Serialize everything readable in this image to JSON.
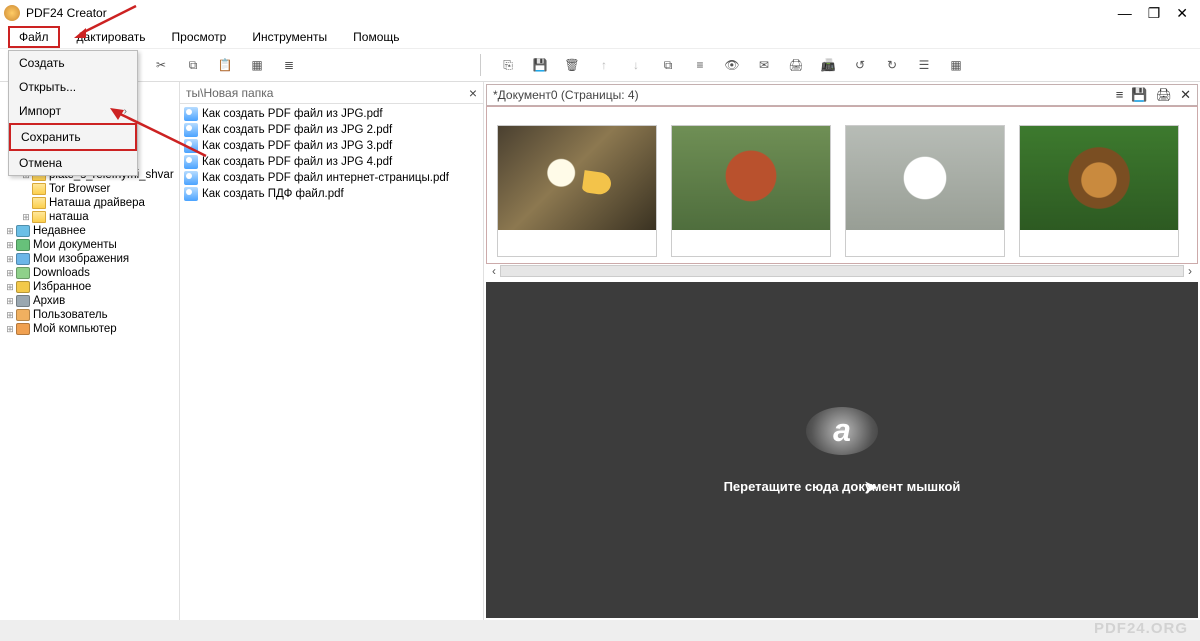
{
  "app": {
    "title": "PDF24 Creator"
  },
  "window_controls": {
    "min": "—",
    "max": "❐",
    "close": "✕"
  },
  "menubar": {
    "file": "Файл",
    "edit": "дактировать",
    "view": "Просмотр",
    "tools": "Инструменты",
    "help": "Помощь"
  },
  "file_menu": {
    "create": "Создать",
    "open": "Открыть...",
    "import": "Импорт",
    "save": "Сохранить",
    "cancel": "Отмена",
    "arrow": "›"
  },
  "left_toolbar_icons": [
    "scissors-icon",
    "copy-icon",
    "clipboard-icon",
    "grid-icon",
    "list-icon"
  ],
  "right_toolbar_icons": [
    "new-doc-icon",
    "save-icon",
    "delete-icon",
    "arrow-up-icon",
    "arrow-down-icon",
    "link-icon",
    "stream-icon",
    "eye-icon",
    "mail-icon",
    "print-icon",
    "fax-icon",
    "rotate-left-icon",
    "rotate-right-icon",
    "properties-icon",
    "tiles-icon"
  ],
  "right_toolbar_dim": [
    "arrow-up-icon",
    "arrow-down-icon"
  ],
  "toolbar_glyphs": {
    "scissors-icon": "✂",
    "copy-icon": "⧉",
    "clipboard-icon": "📋",
    "grid-icon": "▦",
    "list-icon": "≣",
    "new-doc-icon": "⎘",
    "save-icon": "💾",
    "delete-icon": "🗑",
    "arrow-up-icon": "↑",
    "arrow-down-icon": "↓",
    "link-icon": "⧉",
    "stream-icon": "≡",
    "eye-icon": "👁",
    "mail-icon": "✉",
    "print-icon": "🖨",
    "fax-icon": "📠",
    "rotate-left-icon": "↺",
    "rotate-right-icon": "↻",
    "properties-icon": "☰",
    "tiles-icon": "▦"
  },
  "path_bar": {
    "text": "ты\\Новая папка"
  },
  "tree": [
    {
      "exp": "⊞",
      "icon": "folder",
      "label": "plate_s_relefnymi_shvar",
      "indent": 1
    },
    {
      "exp": "",
      "icon": "folder",
      "label": "Tor Browser",
      "indent": 1
    },
    {
      "exp": "",
      "icon": "folder",
      "label": "Наташа драйвера",
      "indent": 1
    },
    {
      "exp": "⊞",
      "icon": "folder",
      "label": "наташа",
      "indent": 1
    },
    {
      "exp": "⊞",
      "icon": "recent",
      "label": "Недавнее",
      "indent": 0
    },
    {
      "exp": "⊞",
      "icon": "docs",
      "label": "Мои документы",
      "indent": 0
    },
    {
      "exp": "⊞",
      "icon": "images",
      "label": "Мои изображения",
      "indent": 0
    },
    {
      "exp": "⊞",
      "icon": "downloads",
      "label": "Downloads",
      "indent": 0
    },
    {
      "exp": "⊞",
      "icon": "fav",
      "label": "Избранное",
      "indent": 0
    },
    {
      "exp": "⊞",
      "icon": "archive",
      "label": "Архив",
      "indent": 0
    },
    {
      "exp": "⊞",
      "icon": "user",
      "label": "Пользователь",
      "indent": 0
    },
    {
      "exp": "⊞",
      "icon": "computer",
      "label": "Мой компьютер",
      "indent": 0
    }
  ],
  "tree_icon_colors": {
    "folder": "folder-ic",
    "recent": "#6bbfe6",
    "docs": "#67c17a",
    "images": "#6cb6e8",
    "downloads": "#8fd18a",
    "fav": "#f3c94a",
    "archive": "#9aa7b0",
    "user": "#f0b060",
    "computer": "#f0a050"
  },
  "files": [
    "Как создать PDF файл из JPG.pdf",
    "Как создать PDF файл из JPG 2.pdf",
    "Как создать PDF файл из JPG 3.pdf",
    "Как создать PDF файл из JPG 4.pdf",
    "Как создать PDF файл интернет-страницы.pdf",
    "Как создать ПДФ файл.pdf"
  ],
  "doc_header": {
    "title": "*Документ0 (Страницы: 4)"
  },
  "doc_header_icons": [
    "menu-icon",
    "save-icon",
    "print-icon",
    "close-icon"
  ],
  "doc_header_glyphs": {
    "menu-icon": "≡",
    "save-icon": "💾",
    "print-icon": "🖨",
    "close-icon": "✕"
  },
  "thumbs": [
    {
      "name": "page-thumb-1",
      "cls": "eagle"
    },
    {
      "name": "page-thumb-2",
      "cls": "redpanda"
    },
    {
      "name": "page-thumb-3",
      "cls": "cat"
    },
    {
      "name": "page-thumb-4",
      "cls": "lion"
    }
  ],
  "scroll": {
    "left": "‹",
    "right": "›"
  },
  "dropzone": {
    "logo": "a",
    "text": "Перетащите сюда документ мышкой"
  },
  "watermark": "PDF24.ORG"
}
